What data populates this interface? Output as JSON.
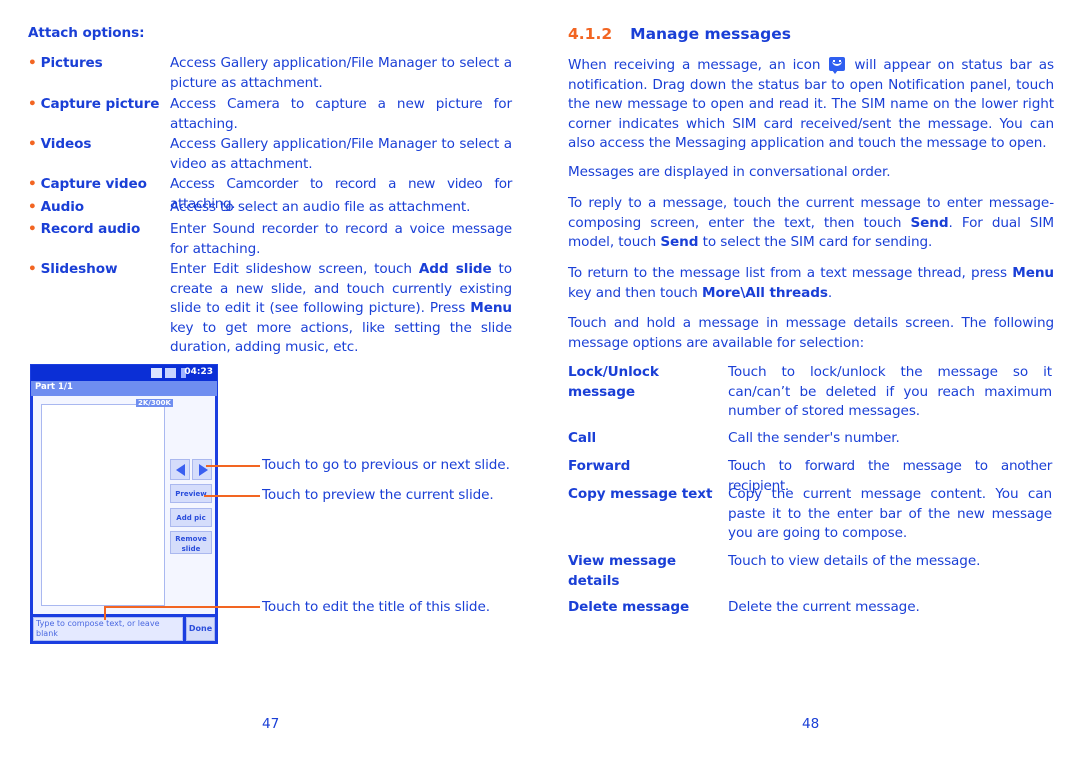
{
  "left_page": {
    "attach_heading": "Attach options:",
    "attach_options": [
      {
        "label": "Pictures",
        "desc": "Access Gallery application/File Manager to select a picture as attachment."
      },
      {
        "label": "Capture picture",
        "desc": "Access Camera to capture a new picture for attaching."
      },
      {
        "label": "Videos",
        "desc": "Access Gallery application/File Manager to select a video as attachment."
      },
      {
        "label": "Capture video",
        "desc": "Access Camcorder to record a new video for attaching."
      },
      {
        "label": "Audio",
        "desc": "Access to select an audio file as attachment."
      },
      {
        "label": "Record audio",
        "desc": "Enter Sound recorder to record a voice message for attaching."
      },
      {
        "label": "Slideshow",
        "desc_parts": [
          "Enter Edit slideshow screen, touch ",
          "Add slide",
          " to create a new slide, and touch currently existing slide to edit it (see following picture). Press ",
          "Menu",
          " key to get more actions, like setting the slide duration, adding music, etc."
        ]
      }
    ],
    "phone": {
      "clock": "04:23",
      "title": "Part 1/1",
      "size_badge": "2K/300K",
      "buttons": {
        "preview": "Preview",
        "add_pic": "Add pic",
        "remove_slide_line1": "Remove",
        "remove_slide_line2": "slide",
        "done": "Done"
      },
      "compose_placeholder": "Type to compose text, or leave blank"
    },
    "callouts": {
      "nav": "Touch to go to previous or next slide.",
      "preview": "Touch to preview the current slide.",
      "title": "Touch to edit the title of this slide."
    },
    "page_number": "47"
  },
  "right_page": {
    "section_number": "4.1.2",
    "section_title": "Manage messages",
    "intro_before_icon": "When receiving a message, an icon",
    "intro_after_icon": "will appear on status bar as notification. Drag down the status bar to open Notification panel, touch the new message to open and read it. The SIM name on the lower right corner indicates which SIM card received/sent the message. You can also access the Messaging application and touch the message to open.",
    "order_text": "Messages are displayed in conversational order.",
    "reply_parts": [
      "To reply to a message, touch the current message to enter message-composing screen, enter the text, then touch ",
      "Send",
      ". For dual SIM model, touch ",
      "Send",
      " to select the SIM card for sending."
    ],
    "return_parts": [
      "To return to the message list from a text message thread, press ",
      "Menu",
      " key and then touch ",
      "More\\All threads",
      "."
    ],
    "hold_text": "Touch and hold a message in message details screen. The following message options are available for selection:",
    "message_options": [
      {
        "label": "Lock/Unlock message",
        "desc": "Touch to lock/unlock the message so it can/can’t be deleted if you reach maximum number of stored messages."
      },
      {
        "label": "Call",
        "desc": "Call the sender's number."
      },
      {
        "label": "Forward",
        "desc": "Touch to forward the message to another recipient."
      },
      {
        "label": "Copy message text",
        "desc": "Copy the current message content. You can paste it to the enter bar of the new message you are going to compose."
      },
      {
        "label": "View message details",
        "desc": "Touch to view details of the message."
      },
      {
        "label": "Delete message",
        "desc": "Delete the current message."
      }
    ],
    "page_number": "48"
  },
  "colors": {
    "text": "#1a3fd6",
    "accent": "#f26522"
  }
}
